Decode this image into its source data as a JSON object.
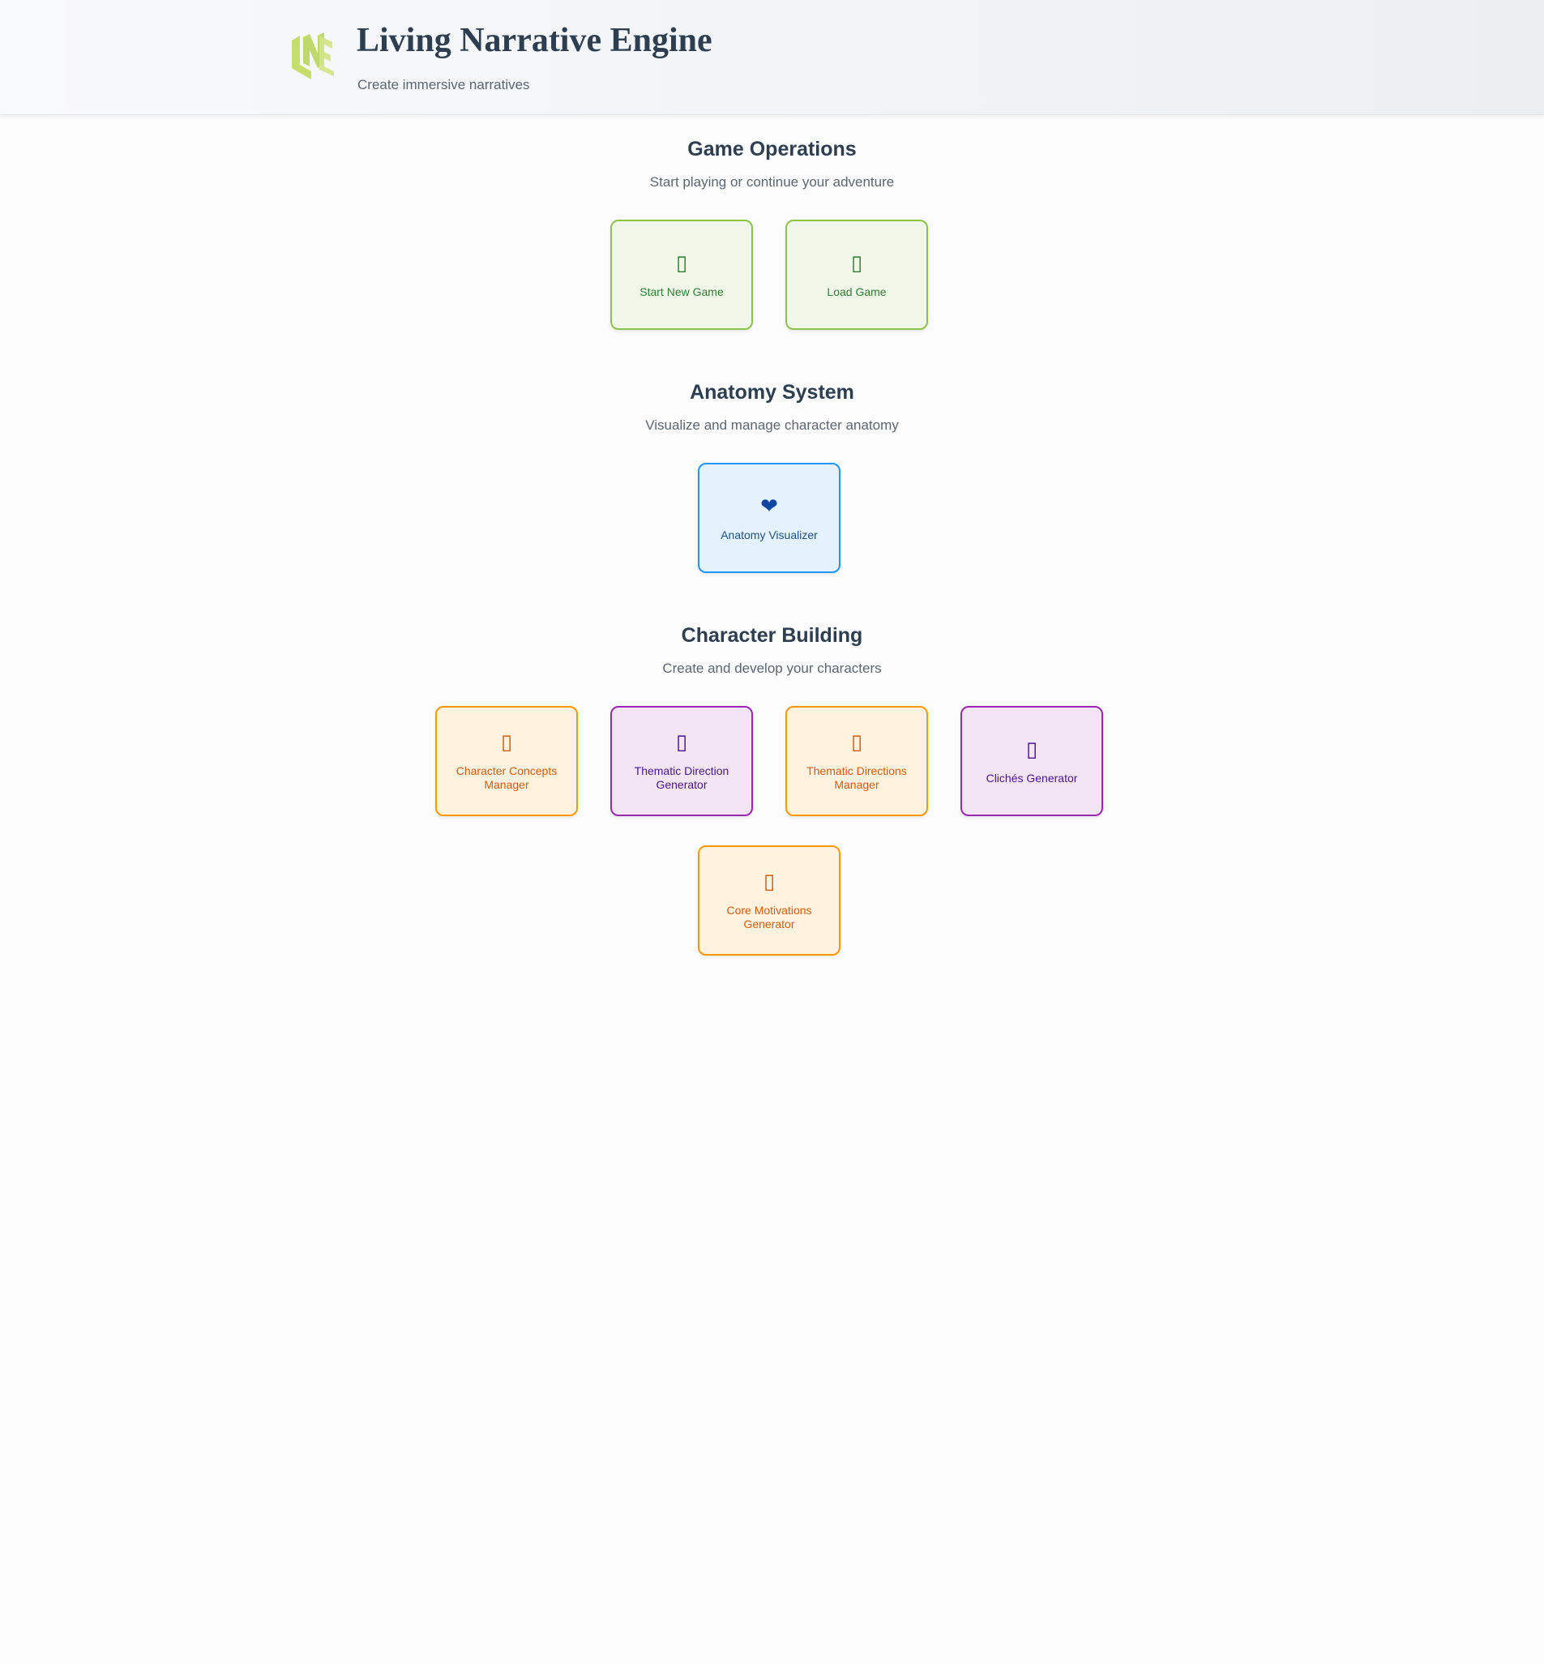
{
  "header": {
    "title": "Living Narrative Engine",
    "subtitle": "Create immersive narratives",
    "logo_text": "LNE",
    "logo_color": "#c5dd6a"
  },
  "sections": [
    {
      "title": "Game Operations",
      "description": "Start playing or continue your adventure",
      "buttons": [
        {
          "label": "Start New Game",
          "icon": "▯",
          "icon_name": "play-icon",
          "color": "green"
        },
        {
          "label": "Load Game",
          "icon": "▯",
          "icon_name": "folder-icon",
          "color": "green"
        }
      ]
    },
    {
      "title": "Anatomy System",
      "description": "Visualize and manage character anatomy",
      "buttons": [
        {
          "label": "Anatomy Visualizer",
          "icon": "❤",
          "icon_name": "heart-icon",
          "color": "blue"
        }
      ]
    },
    {
      "title": "Character Building",
      "description": "Create and develop your characters",
      "buttons": [
        {
          "label": "Character Concepts Manager",
          "icon": "▯",
          "icon_name": "concepts-icon",
          "color": "orange"
        },
        {
          "label": "Thematic Direction Generator",
          "icon": "▯",
          "icon_name": "direction-icon",
          "color": "purple"
        },
        {
          "label": "Thematic Directions Manager",
          "icon": "▯",
          "icon_name": "directions-manager-icon",
          "color": "orange"
        },
        {
          "label": "Clichés Generator",
          "icon": "▯",
          "icon_name": "cliches-icon",
          "color": "purple"
        },
        {
          "label": "Core Motivations Generator",
          "icon": "▯",
          "icon_name": "motivation-icon",
          "color": "orange"
        }
      ]
    }
  ],
  "colors": {
    "green_border": "#8bc34a",
    "blue_border": "#2196f3",
    "orange_border": "#ff9800",
    "purple_border": "#9c27b0"
  }
}
